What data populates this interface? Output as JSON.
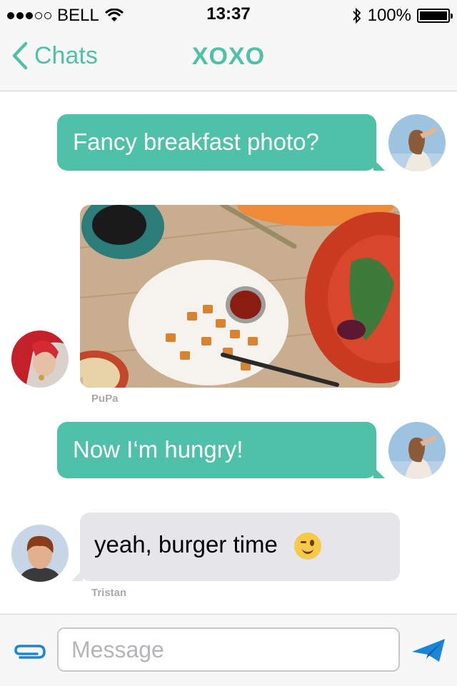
{
  "status_bar": {
    "carrier": "BELL",
    "time": "13:37",
    "battery": "100%"
  },
  "nav": {
    "back_label": "Chats",
    "title": "XOXO"
  },
  "messages": [
    {
      "direction": "outgoing",
      "text": "Fancy breakfast photo?"
    },
    {
      "direction": "incoming",
      "type": "photo",
      "sender": "PuPa"
    },
    {
      "direction": "outgoing",
      "text": "Now I‘m hungry!"
    },
    {
      "direction": "incoming",
      "text": "yeah, burger time",
      "emoji": "wink",
      "sender": "Tristan"
    }
  ],
  "composer": {
    "placeholder": "Message"
  },
  "colors": {
    "accent": "#4fc1a9",
    "incoming_bubble": "#e5e5ea",
    "send_icon": "#1a86d8"
  }
}
